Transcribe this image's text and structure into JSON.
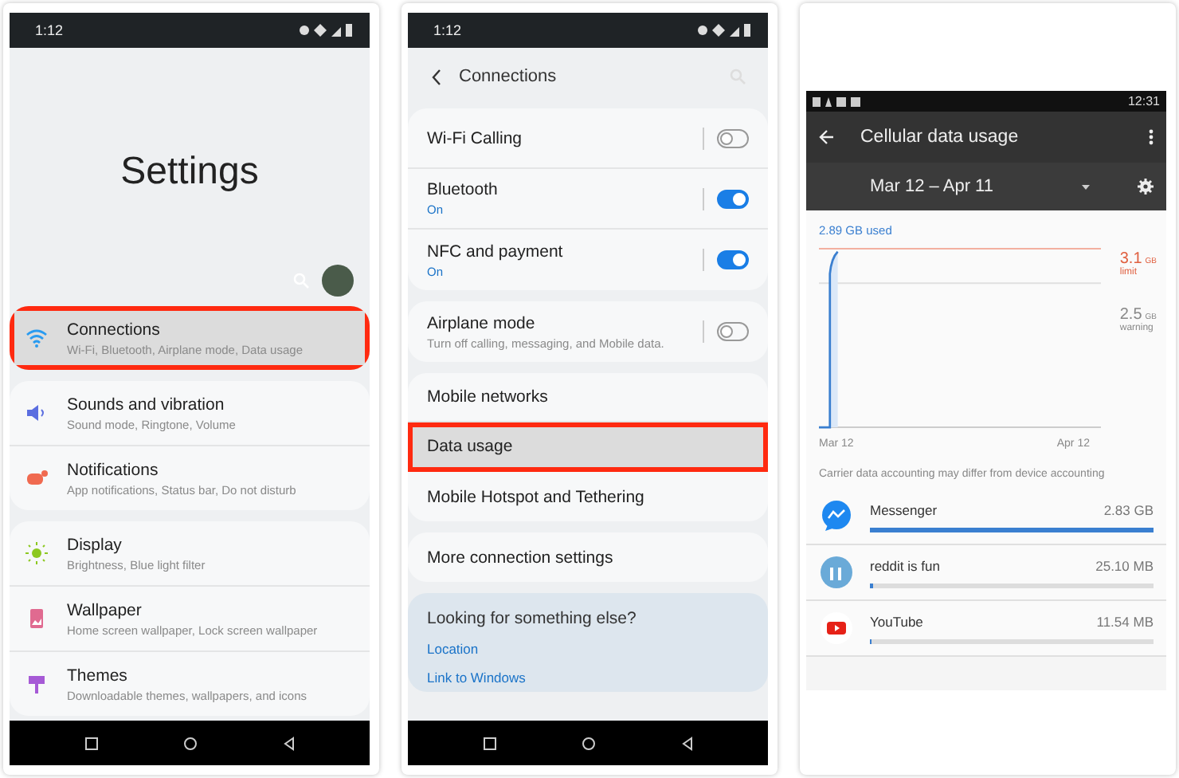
{
  "settings_screen": {
    "status_bar": {
      "time": "1:12"
    },
    "title": "Settings",
    "groups": [
      [
        {
          "title": "Connections",
          "subtitle": "Wi-Fi, Bluetooth, Airplane mode, Data usage",
          "selected": true
        }
      ],
      [
        {
          "title": "Sounds and vibration",
          "subtitle": "Sound mode, Ringtone, Volume",
          "selected": false
        },
        {
          "title": "Notifications",
          "subtitle": "App notifications, Status bar, Do not disturb",
          "selected": false
        }
      ],
      [
        {
          "title": "Display",
          "subtitle": "Brightness, Blue light filter",
          "selected": false
        },
        {
          "title": "Wallpaper",
          "subtitle": "Home screen wallpaper, Lock screen wallpaper",
          "selected": false
        },
        {
          "title": "Themes",
          "subtitle": "Downloadable themes, wallpapers, and icons",
          "selected": false
        }
      ]
    ]
  },
  "connections_screen": {
    "status_bar": {
      "time": "1:12"
    },
    "title": "Connections",
    "groups": [
      [
        {
          "kind": "toggle",
          "title": "Wi-Fi Calling",
          "on": false
        },
        {
          "kind": "toggle",
          "title": "Bluetooth",
          "status": "On",
          "on": true
        },
        {
          "kind": "toggle",
          "title": "NFC and payment",
          "status": "On",
          "on": true
        }
      ],
      [
        {
          "kind": "toggle",
          "title": "Airplane mode",
          "subtitle": "Turn off calling, messaging, and Mobile data.",
          "on": false
        }
      ],
      [
        {
          "kind": "link",
          "title": "Mobile networks",
          "selected": false
        },
        {
          "kind": "link",
          "title": "Data usage",
          "selected": true
        },
        {
          "kind": "link",
          "title": "Mobile Hotspot and Tethering",
          "selected": false
        }
      ],
      [
        {
          "kind": "link",
          "title": "More connection settings",
          "selected": false
        }
      ]
    ],
    "suggestions": {
      "title": "Looking for something else?",
      "links": [
        "Location",
        "Link to Windows"
      ]
    }
  },
  "data_usage_screen": {
    "status_bar": {
      "time": "12:31"
    },
    "title": "Cellular data usage",
    "period": "Mar 12 – Apr 11",
    "used": "2.89 GB used",
    "limit": {
      "value": "3.1",
      "unit": "GB",
      "caption": "limit"
    },
    "warning": {
      "value": "2.5",
      "unit": "GB",
      "caption": "warning"
    },
    "x_start": "Mar 12",
    "x_end": "Apr 12",
    "note": "Carrier data accounting may differ from device accounting",
    "apps": [
      {
        "name": "Messenger",
        "amount": "2.83 GB",
        "level": 1
      },
      {
        "name": "reddit is fun",
        "amount": "25.10 MB",
        "level": 0.01
      },
      {
        "name": "YouTube",
        "amount": "11.54 MB",
        "level": 0.005
      }
    ]
  }
}
